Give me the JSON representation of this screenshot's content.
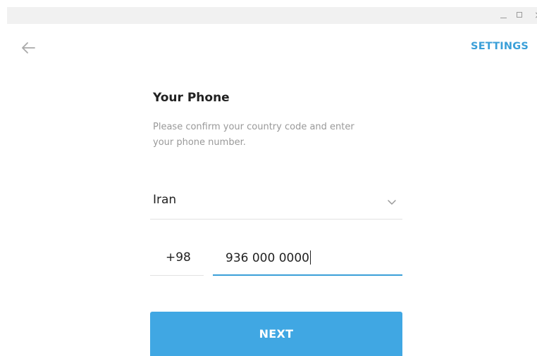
{
  "window": {
    "controls": {
      "minimize_icon": "minimize-icon",
      "maximize_icon": "maximize-icon",
      "close_glyph": "×"
    }
  },
  "header": {
    "back_icon": "arrow-left-icon",
    "settings_label": "SETTINGS"
  },
  "main": {
    "title": "Your Phone",
    "description": "Please confirm your country code and enter your phone number.",
    "country": {
      "selected": "Iran",
      "chevron_icon": "chevron-down-icon"
    },
    "country_code": "+98",
    "phone_number": "936 000 0000",
    "next_label": "NEXT"
  },
  "colors": {
    "accent": "#40a7e3",
    "link": "#3a9fd8",
    "text": "#222222",
    "muted": "#999999",
    "divider": "#e2e2e2",
    "titlebar": "#f1f1f1"
  }
}
